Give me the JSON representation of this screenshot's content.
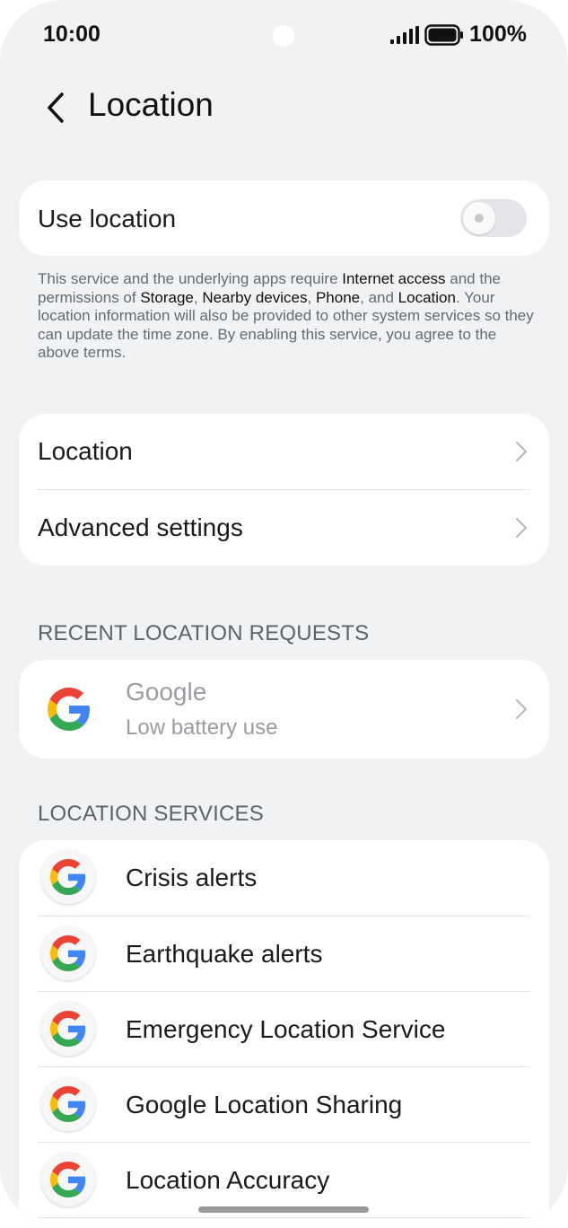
{
  "status_bar": {
    "time": "10:00",
    "battery_pct": "100%"
  },
  "header": {
    "title": "Location",
    "back_icon": "chevron-left-icon"
  },
  "use_location": {
    "label": "Use location",
    "enabled": false
  },
  "description": {
    "t1": "This service and the underlying apps require ",
    "b1": "Internet access",
    "t2": " and the permissions of ",
    "b2": "Storage",
    "t3": ", ",
    "b3": "Nearby devices",
    "t4": ", ",
    "b4": "Phone",
    "t5": ", and ",
    "b5": "Location",
    "t6": ". Your location information will also be provided to other system services so they can update the time zone. By enabling this service, you agree to the above terms."
  },
  "nav_items": [
    {
      "label": "Location"
    },
    {
      "label": "Advanced settings"
    }
  ],
  "recent_requests": {
    "header": "RECENT LOCATION REQUESTS",
    "items": [
      {
        "name": "Google",
        "subtitle": "Low battery use"
      }
    ]
  },
  "location_services": {
    "header": "LOCATION SERVICES",
    "items": [
      {
        "label": "Crisis alerts"
      },
      {
        "label": "Earthquake alerts"
      },
      {
        "label": "Emergency Location Service"
      },
      {
        "label": "Google Location Sharing"
      },
      {
        "label": "Location Accuracy"
      }
    ]
  },
  "colors": {
    "background": "#f1f2f4",
    "card": "#ffffff",
    "google_blue": "#4285F4",
    "google_red": "#EA4335",
    "google_yellow": "#FBBC05",
    "google_green": "#34A853"
  }
}
